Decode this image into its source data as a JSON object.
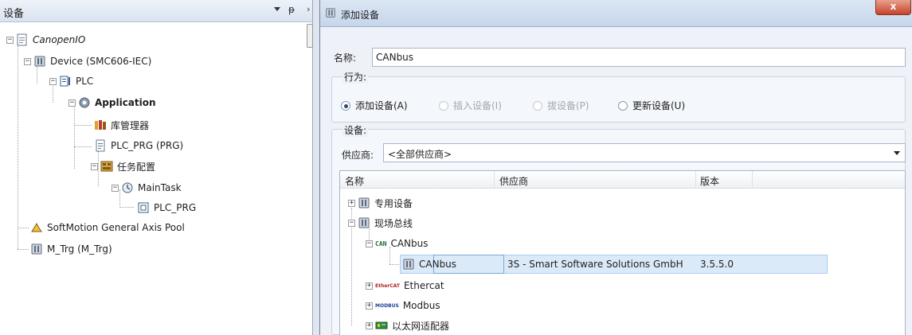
{
  "left_panel": {
    "title": "设备",
    "pin_glyph": "ᵽ",
    "close_glyph": "›",
    "tree": {
      "root": "CanopenIO",
      "device": "Device (SMC606-IEC)",
      "plc": "PLC",
      "application": "Application",
      "library_manager": "库管理器",
      "plc_prg": "PLC_PRG (PRG)",
      "task_config": "任务配置",
      "main_task": "MainTask",
      "main_task_prg": "PLC_PRG",
      "axis_pool": "SoftMotion General Axis Pool",
      "m_trg": "M_Trg (M_Trg)"
    }
  },
  "dialog": {
    "title": "添加设备",
    "close_glyph": "x",
    "name_label": "名称:",
    "name_value": "CANbus",
    "behavior": {
      "title": "行为:",
      "options": [
        {
          "label": "添加设备(A)",
          "selected": true,
          "enabled": true
        },
        {
          "label": "插入设备(I)",
          "selected": false,
          "enabled": false
        },
        {
          "label": "拔设备(P)",
          "selected": false,
          "enabled": false
        },
        {
          "label": "更新设备(U)",
          "selected": false,
          "enabled": true
        }
      ]
    },
    "devices": {
      "title": "设备:",
      "vendor_label": "供应商:",
      "vendor_value": "<全部供应商>",
      "columns": [
        "名称",
        "供应商",
        "版本"
      ],
      "tree": {
        "special": "专用设备",
        "fieldbus": "现场总线",
        "canbus_group": "CANbus",
        "canbus_item": {
          "name": "CANbus",
          "vendor": "3S - Smart Software Solutions GmbH",
          "version": "3.5.5.0"
        },
        "ethercat": "Ethercat",
        "modbus": "Modbus",
        "ethernet_adapter": "以太网适配器"
      },
      "icon_text": {
        "can": "CAN",
        "ethercat": "EtherCAT",
        "modbus": "MODBUS"
      }
    }
  },
  "colors": {
    "selection": "#dbeaf9",
    "close_button": "#c7432a",
    "accent": "#2b4a7a"
  }
}
